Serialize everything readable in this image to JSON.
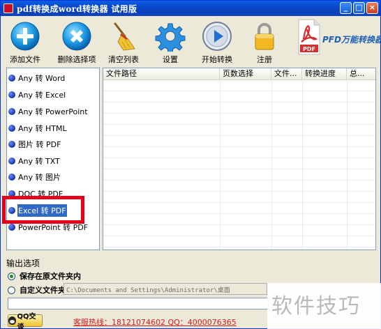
{
  "window": {
    "title": "pdf转换成word转换器 试用版",
    "controls": [
      "minimize",
      "maximize",
      "close"
    ]
  },
  "toolbar": {
    "buttons": [
      {
        "label": "添加文件",
        "icon": "plus-icon"
      },
      {
        "label": "删除选择项",
        "icon": "delete-x-icon"
      },
      {
        "label": "清空列表",
        "icon": "broom-icon"
      },
      {
        "label": "设置",
        "icon": "gear-icon"
      },
      {
        "label": "开始转换",
        "icon": "play-icon"
      },
      {
        "label": "注册",
        "icon": "lock-icon"
      }
    ],
    "brand_text": "PFD万能转换器",
    "logo_text": "PDF"
  },
  "categories": {
    "items": [
      "Any 转 Word",
      "Any 转 Excel",
      "Any 转 PowerPoint",
      "Any 转 HTML",
      "图片 转 PDF",
      "Any 转 TXT",
      "Any 转 图片",
      "DOC 转 PDF",
      "Excel 转 PDF",
      "PowerPoint 转 PDF"
    ],
    "selected": "Excel 转 PDF"
  },
  "file_table": {
    "columns": [
      "文件路径",
      "页数选择",
      "文件...",
      "转换进度",
      "总..."
    ],
    "rows": []
  },
  "output": {
    "section_title": "输出选项",
    "option_same_folder": "保存在原文件夹内",
    "option_custom_folder": "自定义文件夹",
    "selected_option": "保存在原文件夹内",
    "custom_path": "C:\\Documents and Settings\\Administrator\\桌面"
  },
  "footer": {
    "qq_button": "QQ交谈",
    "hotline": "客服热线：18121074602 QQ：4000076365"
  },
  "watermark": "软件技巧",
  "colors": {
    "title_bar": "#0845c6",
    "selection": "#316ac5",
    "highlight_border": "#e4001b",
    "hotline_text": "#d21a1a",
    "brand_text": "#1e5fb4"
  }
}
